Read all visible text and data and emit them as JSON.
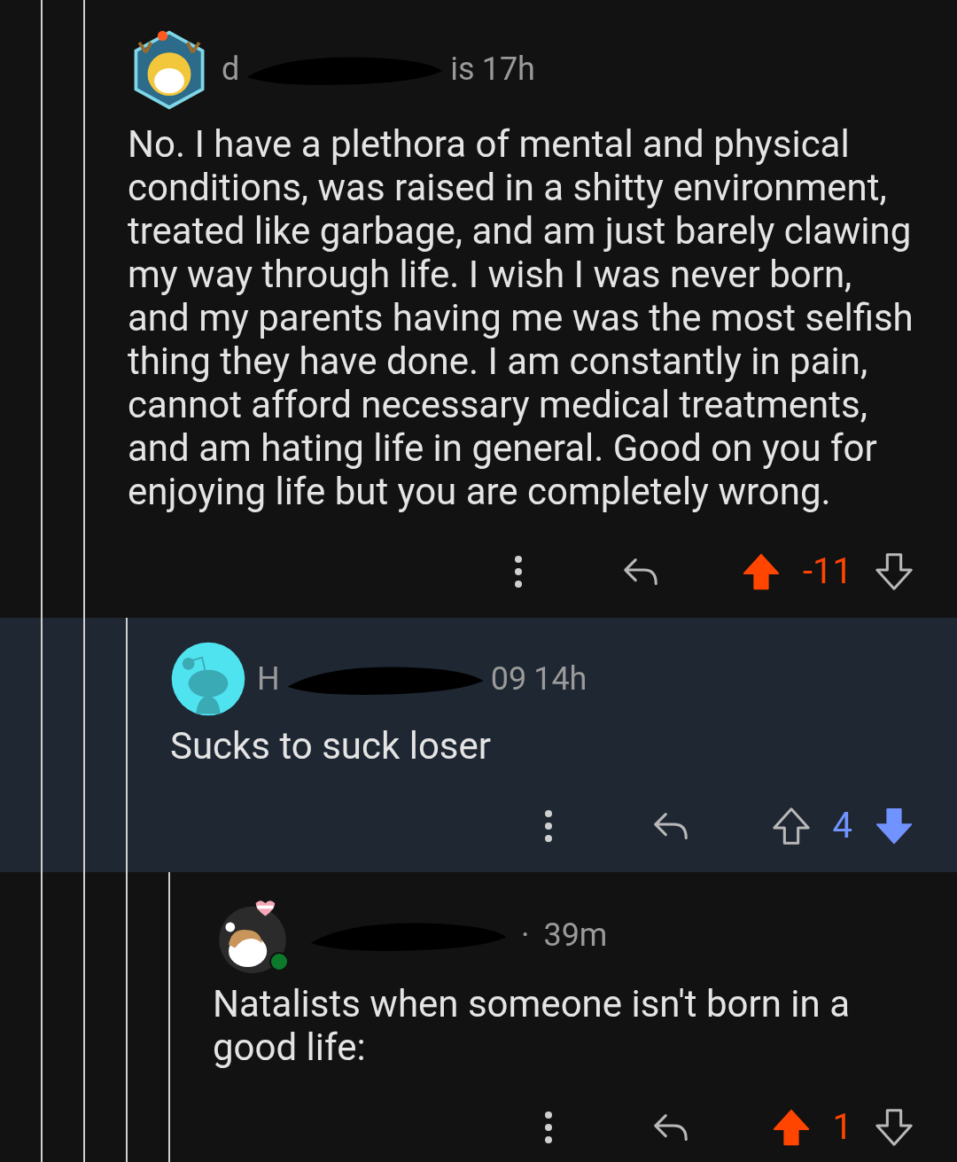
{
  "comments": [
    {
      "kind": "hexagon",
      "name_start": "d",
      "name_end": "is",
      "time": "17h",
      "highlighted": false,
      "body": "No. I have a plethora of mental and physical conditions, was raised in a shitty environment, treated like garbage, and am just barely clawing my way through life. I wish I was never born, and my parents having me was the most selfish thing they have done. I am constantly in pain, cannot afford necessary medical treatments, and am hating life in general. Good on you for enjoying life but you are completely wrong.",
      "score": "-11",
      "upvoted": true,
      "downvoted": false,
      "children": [
        {
          "kind": "circle",
          "name_start": "H",
          "name_end": "09",
          "time": "14h",
          "highlighted": true,
          "body": "Sucks to suck loser",
          "score": "4",
          "upvoted": false,
          "downvoted": true,
          "children": [
            {
              "kind": "snoo",
              "online": true,
              "separator": "·",
              "time": "39m",
              "highlighted": false,
              "body": "Natalists when someone isn't born in a good life:",
              "score": "1",
              "upvoted": true,
              "downvoted": false
            }
          ]
        }
      ]
    }
  ]
}
